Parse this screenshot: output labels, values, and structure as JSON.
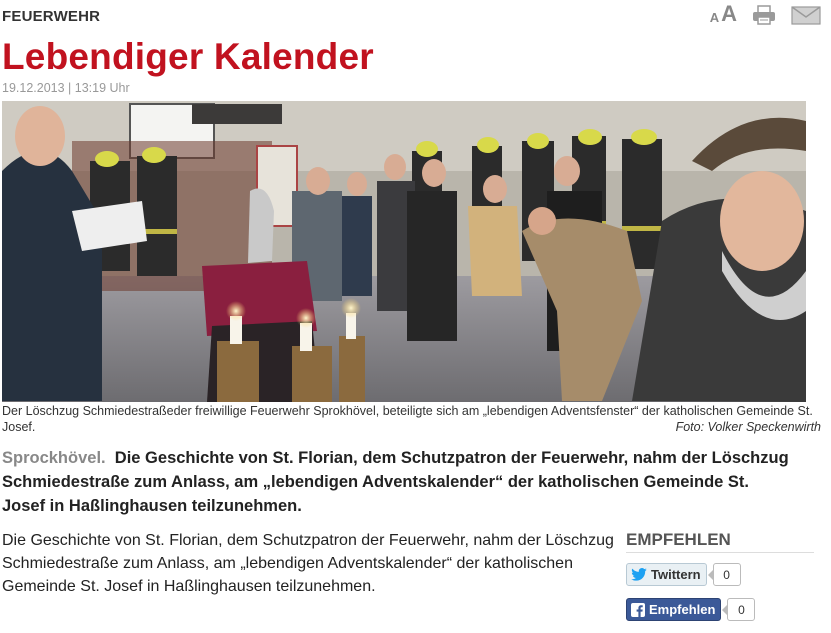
{
  "header": {
    "section": "FEUERWEHR",
    "font_small": "A",
    "font_large": "A",
    "print_icon": "printer-icon",
    "mail_icon": "envelope-icon"
  },
  "article": {
    "title": "Lebendiger Kalender",
    "dateline": "19.12.2013 | 13:19 Uhr",
    "photo_alt": "Der Löschzug Schmiedestraße bei der Feierstunde",
    "caption": "Der Löschzug Schmiedestraßeder freiwillige Feuerwehr Sprokhövel, beteiligte sich am „lebendigen Adventsfenster“ der katholischen Gemeinde St. Josef.",
    "credit": "Foto: Volker Speckenwirth",
    "teaser_place": "Sprockhövel.",
    "teaser_text": "Die Geschichte von St. Florian, dem Schutzpatron der Feuerwehr, nahm der Löschzug Schmiedestraße zum Anlass, am „lebendigen Adventskalender“ der katholischen Gemeinde St. Josef in Haßlinghausen teilzunehmen.",
    "body": "Die Geschichte von St. Florian, dem Schutzpatron der Feuerwehr, nahm der Löschzug Schmiedestraße zum Anlass, am „lebendigen Adventskalender“ der katholischen Gemeinde St. Josef in Haßlinghausen teilzunehmen."
  },
  "share": {
    "title": "EMPFEHLEN",
    "twitter_label": "Twittern",
    "twitter_count": "0",
    "facebook_label": "Empfehlen",
    "facebook_count": "0"
  },
  "colors": {
    "headline": "#c1121f",
    "facebook": "#3b5998",
    "twitter": "#1da1f2"
  }
}
